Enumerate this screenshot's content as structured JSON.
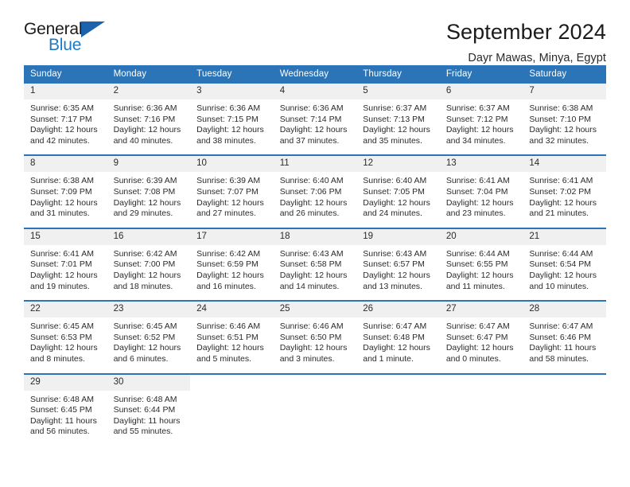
{
  "brand": {
    "name_part1": "General",
    "name_part2": "Blue",
    "accent_color": "#1e7ac4",
    "sail_color": "#1c62ad"
  },
  "header": {
    "title": "September 2024",
    "subtitle": "Dayr Mawas, Minya, Egypt",
    "header_bg_color": "#2b74b7",
    "daynum_bg_color": "#f0f0f0"
  },
  "weekday_headers": [
    "Sunday",
    "Monday",
    "Tuesday",
    "Wednesday",
    "Thursday",
    "Friday",
    "Saturday"
  ],
  "weeks": [
    [
      {
        "day": "1",
        "sunrise": "Sunrise: 6:35 AM",
        "sunset": "Sunset: 7:17 PM",
        "daylight1": "Daylight: 12 hours",
        "daylight2": "and 42 minutes."
      },
      {
        "day": "2",
        "sunrise": "Sunrise: 6:36 AM",
        "sunset": "Sunset: 7:16 PM",
        "daylight1": "Daylight: 12 hours",
        "daylight2": "and 40 minutes."
      },
      {
        "day": "3",
        "sunrise": "Sunrise: 6:36 AM",
        "sunset": "Sunset: 7:15 PM",
        "daylight1": "Daylight: 12 hours",
        "daylight2": "and 38 minutes."
      },
      {
        "day": "4",
        "sunrise": "Sunrise: 6:36 AM",
        "sunset": "Sunset: 7:14 PM",
        "daylight1": "Daylight: 12 hours",
        "daylight2": "and 37 minutes."
      },
      {
        "day": "5",
        "sunrise": "Sunrise: 6:37 AM",
        "sunset": "Sunset: 7:13 PM",
        "daylight1": "Daylight: 12 hours",
        "daylight2": "and 35 minutes."
      },
      {
        "day": "6",
        "sunrise": "Sunrise: 6:37 AM",
        "sunset": "Sunset: 7:12 PM",
        "daylight1": "Daylight: 12 hours",
        "daylight2": "and 34 minutes."
      },
      {
        "day": "7",
        "sunrise": "Sunrise: 6:38 AM",
        "sunset": "Sunset: 7:10 PM",
        "daylight1": "Daylight: 12 hours",
        "daylight2": "and 32 minutes."
      }
    ],
    [
      {
        "day": "8",
        "sunrise": "Sunrise: 6:38 AM",
        "sunset": "Sunset: 7:09 PM",
        "daylight1": "Daylight: 12 hours",
        "daylight2": "and 31 minutes."
      },
      {
        "day": "9",
        "sunrise": "Sunrise: 6:39 AM",
        "sunset": "Sunset: 7:08 PM",
        "daylight1": "Daylight: 12 hours",
        "daylight2": "and 29 minutes."
      },
      {
        "day": "10",
        "sunrise": "Sunrise: 6:39 AM",
        "sunset": "Sunset: 7:07 PM",
        "daylight1": "Daylight: 12 hours",
        "daylight2": "and 27 minutes."
      },
      {
        "day": "11",
        "sunrise": "Sunrise: 6:40 AM",
        "sunset": "Sunset: 7:06 PM",
        "daylight1": "Daylight: 12 hours",
        "daylight2": "and 26 minutes."
      },
      {
        "day": "12",
        "sunrise": "Sunrise: 6:40 AM",
        "sunset": "Sunset: 7:05 PM",
        "daylight1": "Daylight: 12 hours",
        "daylight2": "and 24 minutes."
      },
      {
        "day": "13",
        "sunrise": "Sunrise: 6:41 AM",
        "sunset": "Sunset: 7:04 PM",
        "daylight1": "Daylight: 12 hours",
        "daylight2": "and 23 minutes."
      },
      {
        "day": "14",
        "sunrise": "Sunrise: 6:41 AM",
        "sunset": "Sunset: 7:02 PM",
        "daylight1": "Daylight: 12 hours",
        "daylight2": "and 21 minutes."
      }
    ],
    [
      {
        "day": "15",
        "sunrise": "Sunrise: 6:41 AM",
        "sunset": "Sunset: 7:01 PM",
        "daylight1": "Daylight: 12 hours",
        "daylight2": "and 19 minutes."
      },
      {
        "day": "16",
        "sunrise": "Sunrise: 6:42 AM",
        "sunset": "Sunset: 7:00 PM",
        "daylight1": "Daylight: 12 hours",
        "daylight2": "and 18 minutes."
      },
      {
        "day": "17",
        "sunrise": "Sunrise: 6:42 AM",
        "sunset": "Sunset: 6:59 PM",
        "daylight1": "Daylight: 12 hours",
        "daylight2": "and 16 minutes."
      },
      {
        "day": "18",
        "sunrise": "Sunrise: 6:43 AM",
        "sunset": "Sunset: 6:58 PM",
        "daylight1": "Daylight: 12 hours",
        "daylight2": "and 14 minutes."
      },
      {
        "day": "19",
        "sunrise": "Sunrise: 6:43 AM",
        "sunset": "Sunset: 6:57 PM",
        "daylight1": "Daylight: 12 hours",
        "daylight2": "and 13 minutes."
      },
      {
        "day": "20",
        "sunrise": "Sunrise: 6:44 AM",
        "sunset": "Sunset: 6:55 PM",
        "daylight1": "Daylight: 12 hours",
        "daylight2": "and 11 minutes."
      },
      {
        "day": "21",
        "sunrise": "Sunrise: 6:44 AM",
        "sunset": "Sunset: 6:54 PM",
        "daylight1": "Daylight: 12 hours",
        "daylight2": "and 10 minutes."
      }
    ],
    [
      {
        "day": "22",
        "sunrise": "Sunrise: 6:45 AM",
        "sunset": "Sunset: 6:53 PM",
        "daylight1": "Daylight: 12 hours",
        "daylight2": "and 8 minutes."
      },
      {
        "day": "23",
        "sunrise": "Sunrise: 6:45 AM",
        "sunset": "Sunset: 6:52 PM",
        "daylight1": "Daylight: 12 hours",
        "daylight2": "and 6 minutes."
      },
      {
        "day": "24",
        "sunrise": "Sunrise: 6:46 AM",
        "sunset": "Sunset: 6:51 PM",
        "daylight1": "Daylight: 12 hours",
        "daylight2": "and 5 minutes."
      },
      {
        "day": "25",
        "sunrise": "Sunrise: 6:46 AM",
        "sunset": "Sunset: 6:50 PM",
        "daylight1": "Daylight: 12 hours",
        "daylight2": "and 3 minutes."
      },
      {
        "day": "26",
        "sunrise": "Sunrise: 6:47 AM",
        "sunset": "Sunset: 6:48 PM",
        "daylight1": "Daylight: 12 hours",
        "daylight2": "and 1 minute."
      },
      {
        "day": "27",
        "sunrise": "Sunrise: 6:47 AM",
        "sunset": "Sunset: 6:47 PM",
        "daylight1": "Daylight: 12 hours",
        "daylight2": "and 0 minutes."
      },
      {
        "day": "28",
        "sunrise": "Sunrise: 6:47 AM",
        "sunset": "Sunset: 6:46 PM",
        "daylight1": "Daylight: 11 hours",
        "daylight2": "and 58 minutes."
      }
    ],
    [
      {
        "day": "29",
        "sunrise": "Sunrise: 6:48 AM",
        "sunset": "Sunset: 6:45 PM",
        "daylight1": "Daylight: 11 hours",
        "daylight2": "and 56 minutes."
      },
      {
        "day": "30",
        "sunrise": "Sunrise: 6:48 AM",
        "sunset": "Sunset: 6:44 PM",
        "daylight1": "Daylight: 11 hours",
        "daylight2": "and 55 minutes."
      },
      {
        "day": "",
        "sunrise": "",
        "sunset": "",
        "daylight1": "",
        "daylight2": ""
      },
      {
        "day": "",
        "sunrise": "",
        "sunset": "",
        "daylight1": "",
        "daylight2": ""
      },
      {
        "day": "",
        "sunrise": "",
        "sunset": "",
        "daylight1": "",
        "daylight2": ""
      },
      {
        "day": "",
        "sunrise": "",
        "sunset": "",
        "daylight1": "",
        "daylight2": ""
      },
      {
        "day": "",
        "sunrise": "",
        "sunset": "",
        "daylight1": "",
        "daylight2": ""
      }
    ]
  ]
}
